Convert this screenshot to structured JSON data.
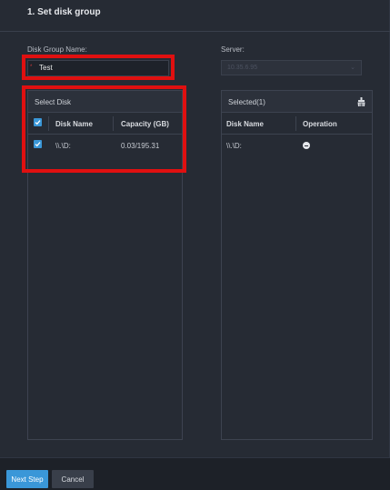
{
  "step": {
    "title": "1. Set disk group"
  },
  "form": {
    "group_name_label": "Disk Group Name:",
    "group_name_value": "Test",
    "required_mark": "*",
    "server_label": "Server:",
    "server_value": "10.35.6.95"
  },
  "select_disk": {
    "header": "Select Disk",
    "columns": [
      "Disk Name",
      "Capacity (GB)"
    ],
    "rows": [
      {
        "name": "\\\\.\\D:",
        "capacity": "0.03/195.31",
        "checked": true
      }
    ]
  },
  "selected": {
    "header": "Selected(1)",
    "columns": [
      "Disk Name",
      "Operation"
    ],
    "rows": [
      {
        "name": "\\\\.\\D:"
      }
    ]
  },
  "footer": {
    "next_label": "Next Step",
    "cancel_label": "Cancel"
  },
  "colors": {
    "accent": "#3a97d8",
    "highlight": "#e01010",
    "background": "#262b34"
  }
}
